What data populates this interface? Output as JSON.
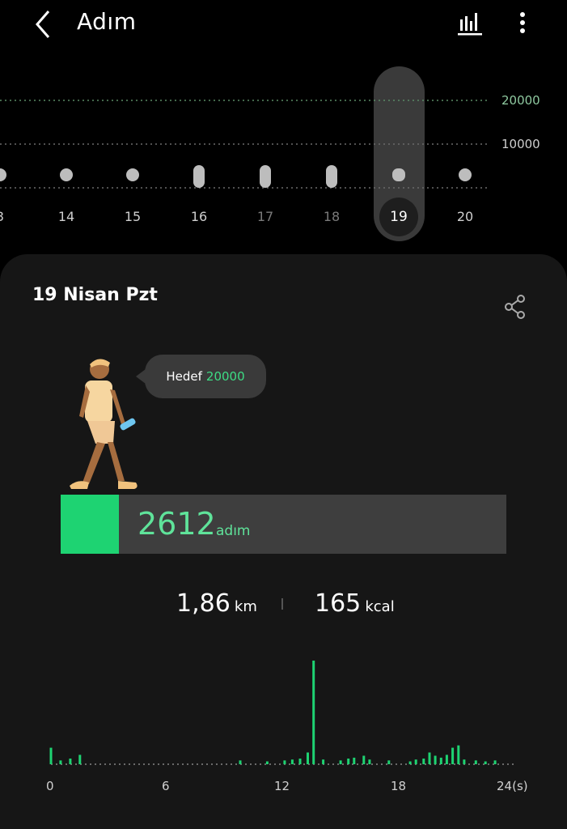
{
  "header": {
    "title": "Adım",
    "back_icon": "chevron-left-icon",
    "chart_icon": "bar-chart-icon",
    "menu_icon": "more-vertical-icon"
  },
  "weekly": {
    "gridlines": [
      "20000",
      "10000"
    ],
    "days": [
      {
        "label": "3",
        "steps": 0
      },
      {
        "label": "14",
        "steps": 0
      },
      {
        "label": "15",
        "steps": 0
      },
      {
        "label": "16",
        "steps": 3600
      },
      {
        "label": "17",
        "steps": 1600
      },
      {
        "label": "18",
        "steps": 1800
      },
      {
        "label": "19",
        "steps": 2612,
        "selected": true
      },
      {
        "label": "20",
        "steps": 0
      }
    ]
  },
  "detail": {
    "date": "19 Nisan Pzt",
    "share_icon": "share-icon",
    "goal_label": "Hedef",
    "goal_value": "20000",
    "goal_progress": 0.13,
    "steps": "2612",
    "steps_unit": "adım",
    "distance": "1,86",
    "distance_unit": "km",
    "calories": "165",
    "calories_unit": "kcal"
  },
  "hourly": {
    "x_labels": [
      "0",
      "6",
      "12",
      "18",
      "24(s)"
    ]
  },
  "colors": {
    "accent": "#1ed372",
    "accent_text": "#5fe39a",
    "card": "#161616"
  },
  "chart_data": {
    "type": "bar",
    "xlabel": "",
    "ylabel": "",
    "x_ticks": [
      "0",
      "6",
      "12",
      "18",
      "24(s)"
    ],
    "hours": [
      0,
      0.5,
      1,
      1.5,
      9.8,
      11.2,
      12.1,
      12.5,
      12.9,
      13.3,
      13.6,
      14.1,
      15,
      15.4,
      15.7,
      16.2,
      16.5,
      17.5,
      18.6,
      18.9,
      19.3,
      19.6,
      19.9,
      20.2,
      20.5,
      20.8,
      21.1,
      21.4,
      22,
      22.5,
      23
    ],
    "values": [
      35,
      8,
      12,
      20,
      8,
      6,
      8,
      10,
      12,
      25,
      220,
      10,
      8,
      12,
      14,
      18,
      10,
      8,
      6,
      10,
      12,
      25,
      18,
      14,
      20,
      35,
      40,
      10,
      8,
      6,
      8
    ]
  }
}
